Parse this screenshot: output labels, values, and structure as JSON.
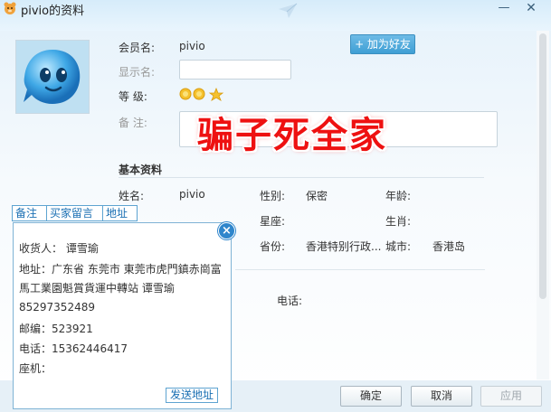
{
  "window": {
    "title": "pivio的资料"
  },
  "header": {
    "member_label": "会员名:",
    "member_value": "pivio",
    "display_label": "显示名:",
    "display_value": "",
    "level_label": "等  级:",
    "remark_label": "备  注:",
    "add_friend": "+ 加为好友",
    "overlay_text": "骗子死全家"
  },
  "basic": {
    "title": "基本资料",
    "name_label": "姓名:",
    "name_value": "pivio",
    "gender_label": "性别:",
    "gender_value": "保密",
    "age_label": "年龄:",
    "age_value": "",
    "constellation_label": "星座:",
    "zodiac_label": "生肖:",
    "province_label": "省份:",
    "province_value": "香港特别行政...",
    "city_label": "城市:",
    "city_value": "香港岛",
    "phone_label": "电话:"
  },
  "popup": {
    "tabs": [
      "备注",
      "买家留言",
      "地址"
    ],
    "recipient": "收货人： 谭雪瑜",
    "address_line1": "地址：广东省 东莞市 東莞市虎門鎮赤崗富",
    "address_line2": "馬工業園魁賞貨運中轉站 谭雪瑜",
    "phone_line": "85297352489",
    "postcode": "邮编：523921",
    "tel": "电话：15362446417",
    "landline": "座机：",
    "send_button": "发送地址",
    "close": "×"
  },
  "buttons": {
    "ok": "确定",
    "cancel": "取消",
    "apply": "应用"
  },
  "window_controls": {
    "minimize": "—",
    "close": "✕"
  },
  "colors": {
    "accent": "#3f9fd4",
    "overlay_red": "#ee1111",
    "tab_blue": "#1a6fb3"
  }
}
